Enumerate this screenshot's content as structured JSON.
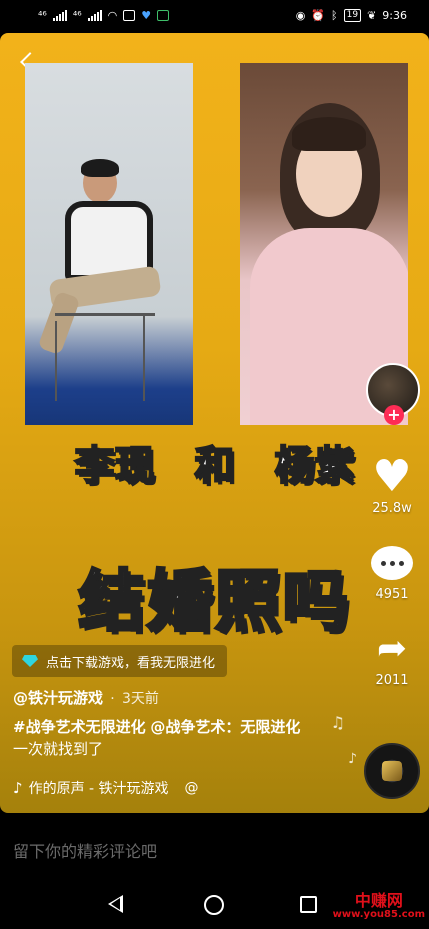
{
  "status_bar": {
    "carrier1": "⁴⁶",
    "carrier2": "⁴⁶",
    "battery": "19",
    "time": "9:36"
  },
  "video": {
    "caption_line1_left": "李现",
    "caption_line1_mid": "和",
    "caption_line1_right": "杨紫",
    "caption_line2": "结婚照吗"
  },
  "rail": {
    "likes": "25.8w",
    "comments": "4951",
    "shares": "2011",
    "follow_symbol": "+"
  },
  "download_banner": {
    "text": "点击下载游戏，看我无限进化"
  },
  "post": {
    "author": "@铁汁玩游戏",
    "separator": "·",
    "time": "3天前",
    "hashtag": "#战争艺术无限进化",
    "mention": "@战争艺术：无限进化",
    "desc_text": "一次就找到了"
  },
  "music": {
    "text": "作的原声 - 铁汁玩游戏",
    "at_symbol": "@"
  },
  "comment_bar": {
    "placeholder": "留下你的精彩评论吧"
  },
  "watermark": {
    "title": "中赚网",
    "url": "www.you85.com"
  }
}
